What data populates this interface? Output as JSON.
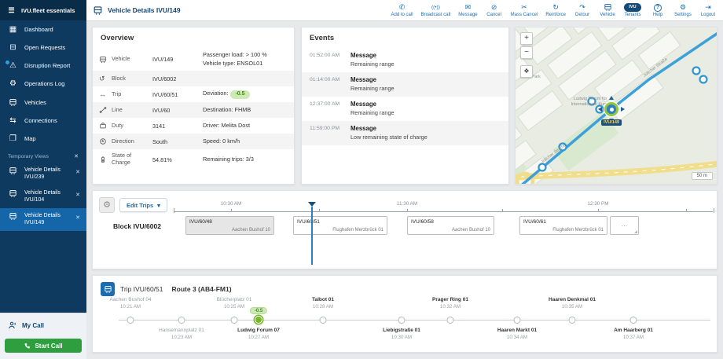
{
  "app": {
    "title": "IVU.fleet essentials"
  },
  "icons": {
    "hamburger": "☰",
    "dashboard": "▦",
    "open_requests": "⊟",
    "disruption": "⚠",
    "operations": "⚙",
    "connections": "⇆",
    "map": "❒",
    "close": "✕",
    "chevron_down": "▾",
    "add_call": "✆",
    "broadcast": "((•))",
    "message": "✉",
    "cancel": "⊘",
    "mass_cancel": "✂",
    "reinforce": "↻",
    "detour": "↷",
    "help": "?",
    "settings": "⚙",
    "logout": "⇥",
    "block": "↺",
    "trip": "↔",
    "gear": "⚙",
    "ellipsis": "…",
    "tenants": "IVU",
    "zoom_in": "+",
    "zoom_out": "−",
    "expand": "❖"
  },
  "sidebar": {
    "items": [
      {
        "label": "Dashboard"
      },
      {
        "label": "Open Requests"
      },
      {
        "label": "Disruption Report"
      },
      {
        "label": "Operations Log"
      },
      {
        "label": "Vehicles"
      },
      {
        "label": "Connections"
      },
      {
        "label": "Map"
      }
    ],
    "temporary_views": {
      "title": "Temporary Views",
      "items": [
        {
          "label": "Vehicle Details",
          "sub": "IVU/239"
        },
        {
          "label": "Vehicle Details",
          "sub": "IVU/104"
        },
        {
          "label": "Vehicle Details",
          "sub": "IVU/149"
        }
      ]
    },
    "my_call": "My Call",
    "start_call": "Start Call"
  },
  "header": {
    "title": "Vehicle Details IVU/149",
    "actions": [
      "Add to call",
      "Broadcast call",
      "Message",
      "Cancel",
      "Mass Cancel",
      "Reinforce",
      "Detour",
      "Vehicle",
      "Tenants",
      "Help",
      "Settings",
      "Logout"
    ]
  },
  "overview": {
    "title": "Overview",
    "rows": [
      {
        "label": "Vehicle",
        "value": "IVU/149",
        "detail": "Passenger load: > 100 %",
        "detail2": "Vehicle type: ENSOL01"
      },
      {
        "label": "Block",
        "value": "IVU/6002",
        "detail": ""
      },
      {
        "label": "Trip",
        "value": "IVU/60/51",
        "detail": "Deviation:",
        "badge": "-0.5"
      },
      {
        "label": "Line",
        "value": "IVU/60",
        "detail": "Destination: FHMB"
      },
      {
        "label": "Duty",
        "value": "3141",
        "detail": "Driver: Melita Dost"
      },
      {
        "label": "Direction",
        "value": "South",
        "detail": "Speed: 0 km/h"
      },
      {
        "label": "State of Charge",
        "value": "54.81%",
        "detail": "Remaining trips: 3/3"
      }
    ]
  },
  "events": {
    "title": "Events",
    "items": [
      {
        "time": "01:52:00 AM",
        "type": "Message",
        "text": "Remaining range"
      },
      {
        "time": "01:14:00 AM",
        "type": "Message",
        "text": "Remaining range"
      },
      {
        "time": "12:37:00 AM",
        "type": "Message",
        "text": "Remaining range"
      },
      {
        "time": "11:59:00 PM",
        "type": "Message",
        "text": "Low remaining state of charge"
      }
    ]
  },
  "map": {
    "vehicle_label": "IVU/149",
    "scale": "50 m",
    "labels": [
      "Lufa-Park",
      "Ludwig Forum für Internationale Kunst",
      "Jülicher Straße",
      "Jülicher Straße"
    ]
  },
  "timeline": {
    "edit_trips": "Edit Trips",
    "block_label": "Block IVU/6002",
    "ticks": [
      "10:30 AM",
      "11:30 AM",
      "12:30 PM"
    ],
    "trips": [
      {
        "id": "IVU/60/48",
        "dest": "Aachen Bushof 10"
      },
      {
        "id": "IVU/60/51",
        "dest": "Flughafen Merzbrück 01"
      },
      {
        "id": "IVU/60/58",
        "dest": "Aachen Bushof 10"
      },
      {
        "id": "IVU/60/61",
        "dest": "Flughafen Merzbrück 01"
      }
    ]
  },
  "trip": {
    "title": "Trip IVU/60/51",
    "route": "Route 3 (AB4-FM1)",
    "deviation_badge": "-0.5",
    "stops": [
      {
        "name": "Aachen Bushof 04",
        "time": "10:21 AM"
      },
      {
        "name": "Hansemannplatz 01",
        "time": "10:23 AM"
      },
      {
        "name": "Blücherplatz 01",
        "time": "10:25 AM"
      },
      {
        "name": "Ludwig Forum 07",
        "time": "10:27 AM"
      },
      {
        "name": "Talbot 01",
        "time": "10:28 AM"
      },
      {
        "name": "Liebigstraße 01",
        "time": "10:30 AM"
      },
      {
        "name": "Prager Ring 01",
        "time": "10:32 AM"
      },
      {
        "name": "Haaren Markt 01",
        "time": "10:34 AM"
      },
      {
        "name": "Haaren Denkmal 01",
        "time": "10:35 AM"
      },
      {
        "name": "Am Haarberg 01",
        "time": "10:37 AM"
      }
    ]
  }
}
